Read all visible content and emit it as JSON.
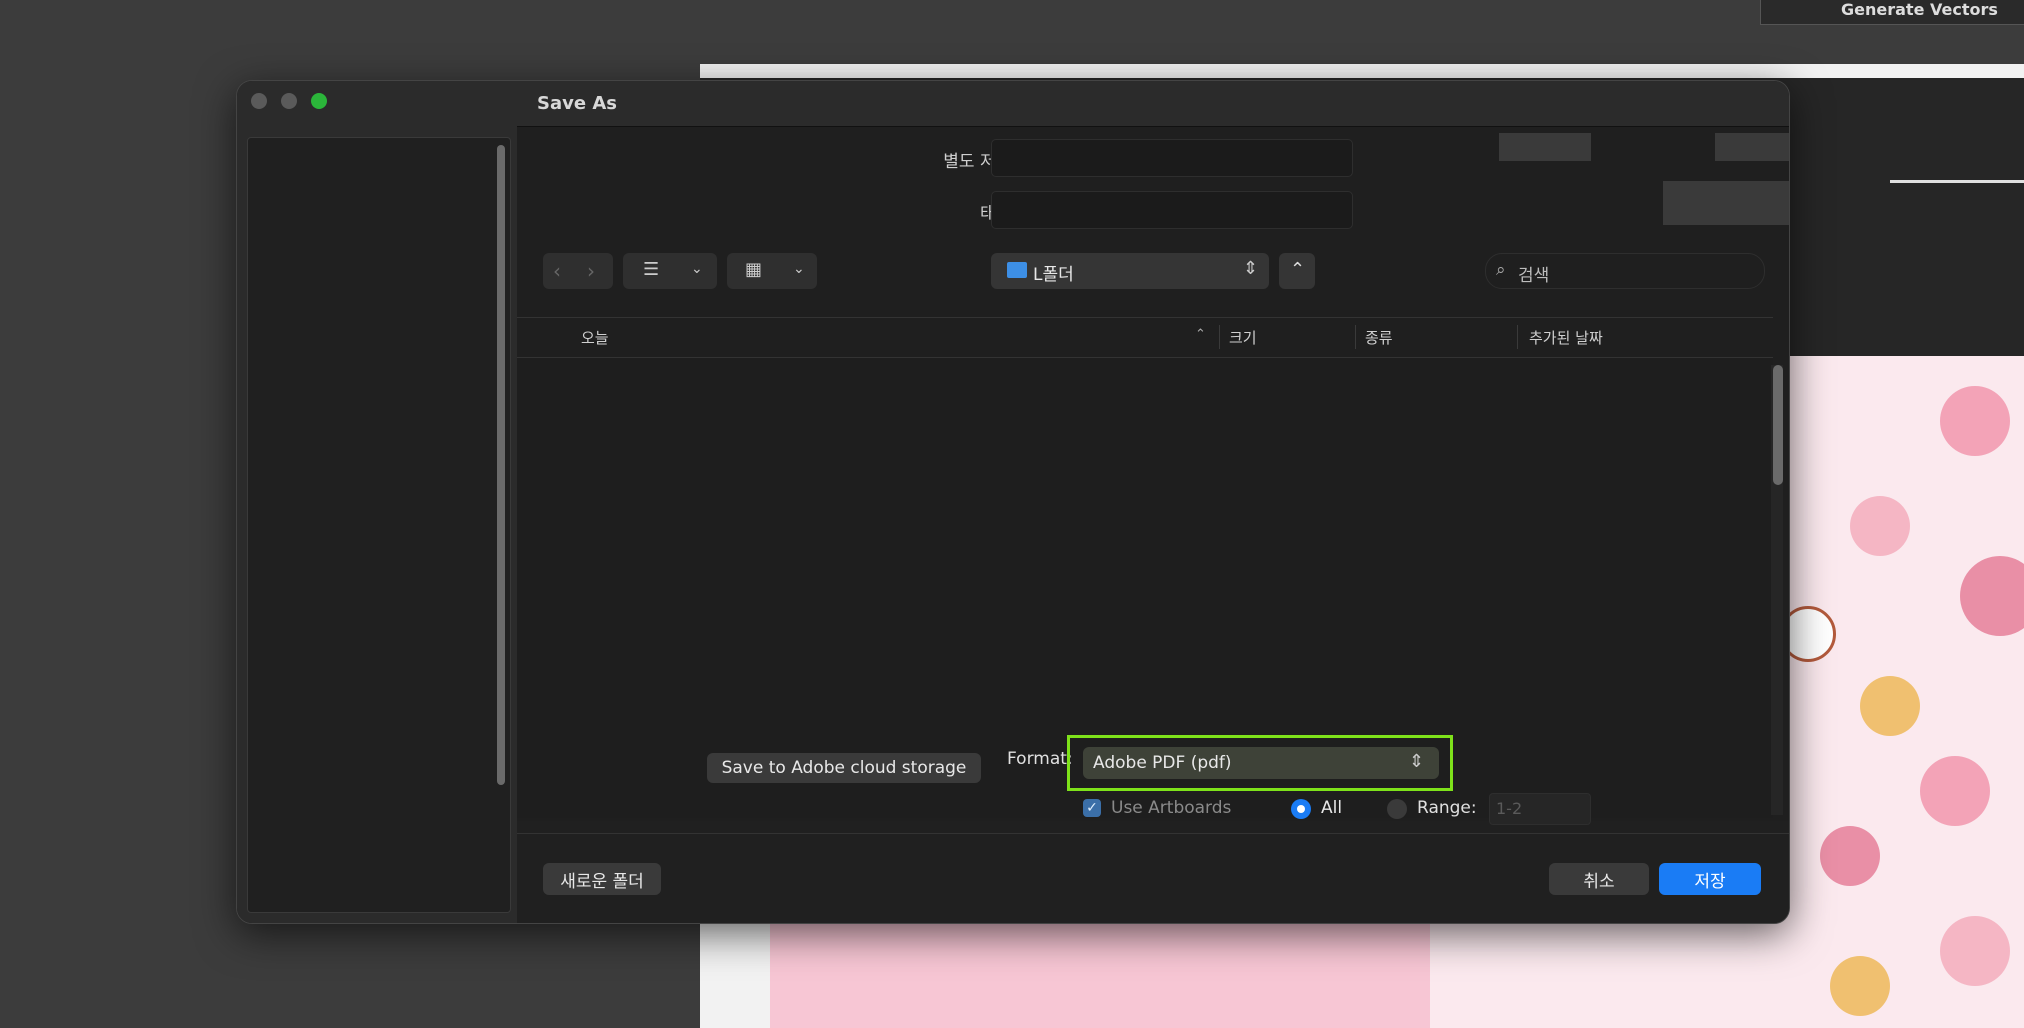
{
  "background": {
    "toolbar_label": "Generate Vectors"
  },
  "dialog": {
    "title": "Save As",
    "save_as_label": "별도 저장:",
    "save_as_value": "",
    "tags_label": "태그:",
    "tags_value": "",
    "location": "L폴더",
    "search_placeholder": "검색",
    "columns": {
      "name": "오늘",
      "size": "크기",
      "kind": "종류",
      "date_added": "추가된 날짜"
    },
    "cloud_button": "Save to Adobe cloud storage",
    "format_label": "Format:",
    "format_value": "Adobe PDF (pdf)",
    "use_artboards_label": "Use Artboards",
    "use_artboards_checked": true,
    "all_label": "All",
    "range_label": "Range:",
    "range_value": "1-2",
    "new_folder_button": "새로운 폴더",
    "cancel_button": "취소",
    "save_button": "저장",
    "highlight_color": "#7ee21a",
    "accent_color": "#1a7cf5"
  }
}
